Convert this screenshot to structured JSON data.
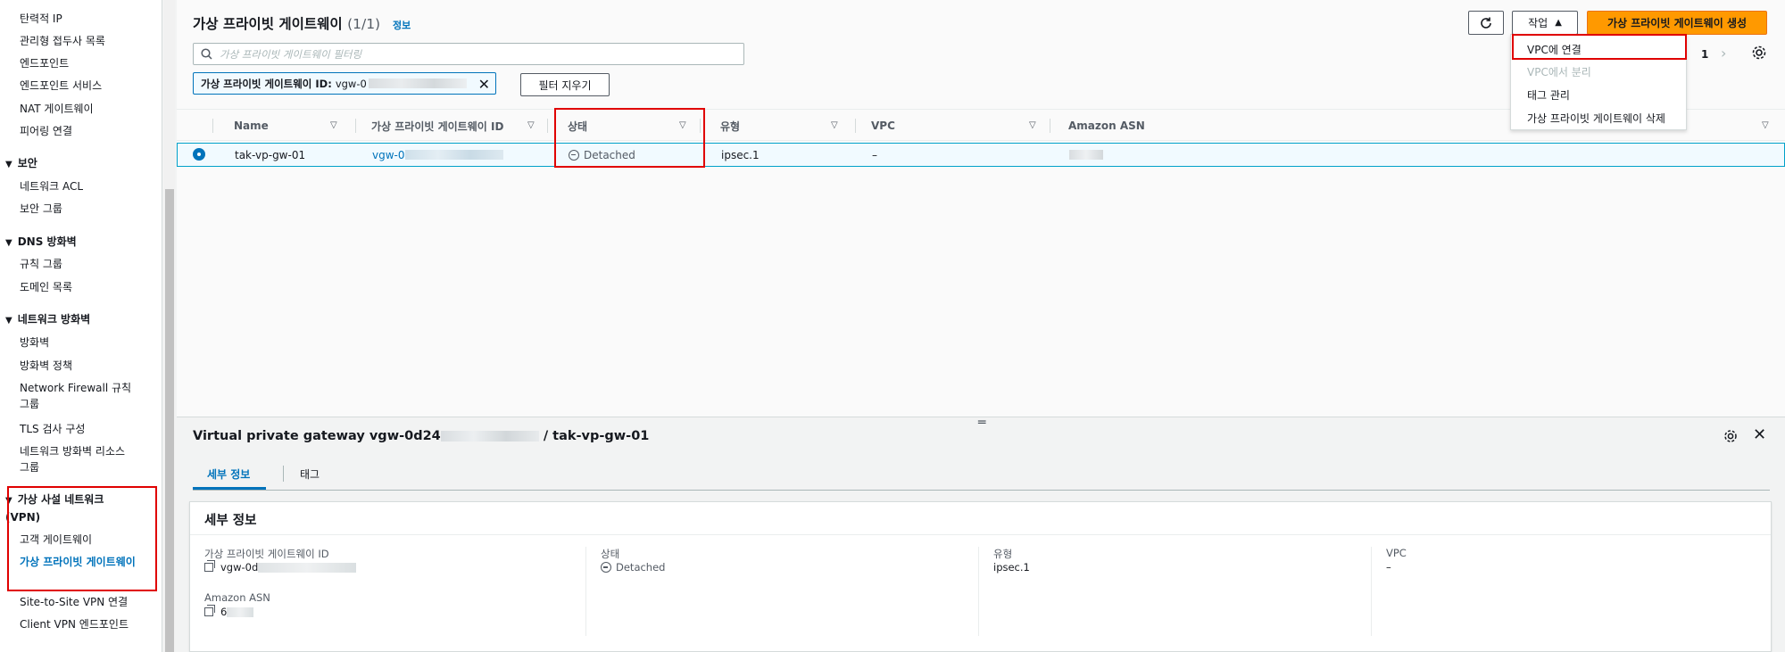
{
  "sidebar": {
    "items_top": [
      "탄력적 IP",
      "관리형 접두사 목록",
      "엔드포인트",
      "엔드포인트 서비스",
      "NAT 게이트웨이",
      "피어링 연결"
    ],
    "security": {
      "title": "보안",
      "items": [
        "네트워크 ACL",
        "보안 그룹"
      ]
    },
    "dns_firewall": {
      "title": "DNS 방화벽",
      "items": [
        "규칙 그룹",
        "도메인 목록"
      ]
    },
    "network_firewall": {
      "title": "네트워크 방화벽",
      "items": [
        "방화벽",
        "방화벽 정책",
        "Network Firewall 규칙 그룹",
        "TLS 검사 구성",
        "네트워크 방화벽 리소스 그룹"
      ]
    },
    "vpn": {
      "title": "가상 사설 네트워크 (VPN)",
      "items": [
        "고객 게이트웨이",
        "가상 프라이빗 게이트웨이",
        "Site-to-Site VPN 연결",
        "Client VPN 엔드포인트"
      ],
      "active_index": 1
    }
  },
  "list": {
    "title": "가상 프라이빗 게이트웨이",
    "count": "(1/1)",
    "info": "정보",
    "actions_label": "작업",
    "create_label": "가상 프라이빗 게이트웨이 생성",
    "filter_placeholder": "가상 프라이빗 게이트웨이 필터링",
    "filter_token_key": "가상 프라이빗 게이트웨이 ID:",
    "filter_token_value": "vgw-0",
    "clear_filters": "필터 지우기",
    "page": "1",
    "columns": [
      "Name",
      "가상 프라이빗 게이트웨이 ID",
      "상태",
      "유형",
      "VPC",
      "Amazon ASN"
    ],
    "row": {
      "name": "tak-vp-gw-01",
      "id_prefix": "vgw-0",
      "state": "Detached",
      "type": "ipsec.1",
      "vpc": "–"
    }
  },
  "menu": {
    "items": [
      "VPC에 연결",
      "VPC에서 분리",
      "태그 관리",
      "가상 프라이빗 게이트웨이 삭제"
    ]
  },
  "detail": {
    "title_prefix": "Virtual private gateway vgw-0d24",
    "title_suffix": "/ tak-vp-gw-01",
    "tabs": [
      "세부 정보",
      "태그"
    ],
    "section_title": "세부 정보",
    "id_label": "가상 프라이빗 게이트웨이 ID",
    "id_value": "vgw-0d",
    "state_label": "상태",
    "state_value": "Detached",
    "type_label": "유형",
    "type_value": "ipsec.1",
    "vpc_label": "VPC",
    "vpc_value": "–",
    "asn_label": "Amazon ASN",
    "asn_value": "6"
  },
  "colors": {
    "accent": "#0073bb",
    "primary_button": "#ff9900",
    "highlight": "#e00000"
  }
}
